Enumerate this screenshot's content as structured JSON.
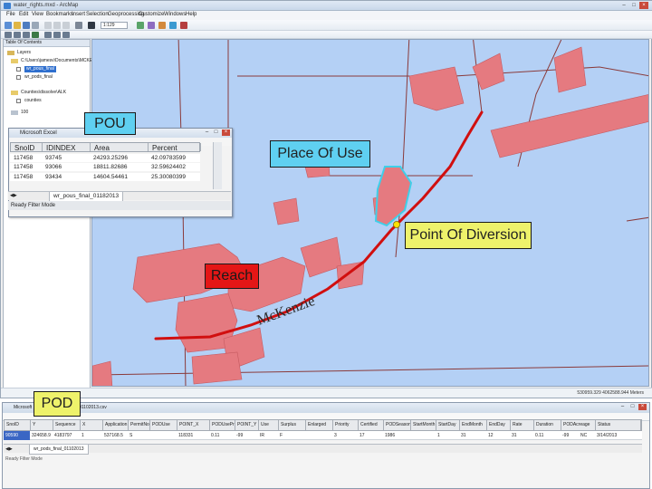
{
  "app": {
    "title": "water_rights.mxd - ArcMap",
    "menus": [
      "File",
      "Edit",
      "View",
      "Bookmarks",
      "Insert",
      "Selection",
      "Geoprocessing",
      "Customize",
      "Windows",
      "Help"
    ],
    "scale": "1:129"
  },
  "toc": {
    "header": "Table Of Contents",
    "items": [
      {
        "label": "Layers"
      },
      {
        "label": "C:\\Users\\jamesv\\Documents\\MCKENZ"
      },
      {
        "label": "wr_pous_final"
      },
      {
        "label": "wr_pods_final"
      },
      {
        "label": "Counties\\dissolve\\ALK"
      },
      {
        "label": "counties"
      },
      {
        "label": "100"
      }
    ]
  },
  "table_popup": {
    "title": "Microsoft Excel",
    "headers": [
      "SnoID",
      "IDINDEX",
      "Area",
      "Percent"
    ],
    "rows": [
      [
        "117458",
        "93745",
        "24293.25296",
        "42.09783599"
      ],
      [
        "117458",
        "93066",
        "18811.82686",
        "32.59624402"
      ],
      [
        "117458",
        "93434",
        "14604.54461",
        "25.30080399"
      ]
    ],
    "tab_label": "wr_pous_final_01182013",
    "status": "Ready    Filter Mode"
  },
  "callouts": {
    "pou": "POU",
    "place_of_use": "Place Of Use",
    "point_of_diversion": "Point Of Diversion",
    "reach": "Reach",
    "pod": "POD"
  },
  "map": {
    "river_name": "McKenzie",
    "coordinate_readout": "530959.329  4062588.944 Meters",
    "colors": {
      "water_background": "#b4d0f5",
      "parcels": "#e57a80",
      "reach": "#d10f0f",
      "place_of_use_outline": "#3fcfe8",
      "roads": "#8a3a3a",
      "point_of_diversion": "#ffe100"
    }
  },
  "csv": {
    "title": "Microsoft Excel - wr_pods_final_01102013.csv",
    "headers": [
      "SnoID",
      "Y",
      "Sequence",
      "X",
      "Application",
      "PermitNo",
      "PODUse",
      "POINT_X",
      "PODUsePriority",
      "POINT_Y",
      "Use",
      "Surplus",
      "Enlarged",
      "Priority",
      "Certified",
      "PODSeason",
      "StartMonth",
      "StartDay",
      "EndMonth",
      "EndDay",
      "Rate",
      "Duration",
      "PODAcreage",
      "Status"
    ],
    "values": [
      "90590",
      "324658.9",
      "4183797",
      "1",
      "537168.5",
      "S",
      "",
      "118331",
      "0.11",
      "-99",
      "IR",
      "F",
      "",
      "3",
      "17",
      "1986",
      "",
      "1",
      "31",
      "12",
      "31",
      "0.11",
      "-99",
      "NC",
      "3/14/2013"
    ],
    "tab_label": "wr_pods_final_01102013",
    "status": "Ready    Filter Mode"
  }
}
